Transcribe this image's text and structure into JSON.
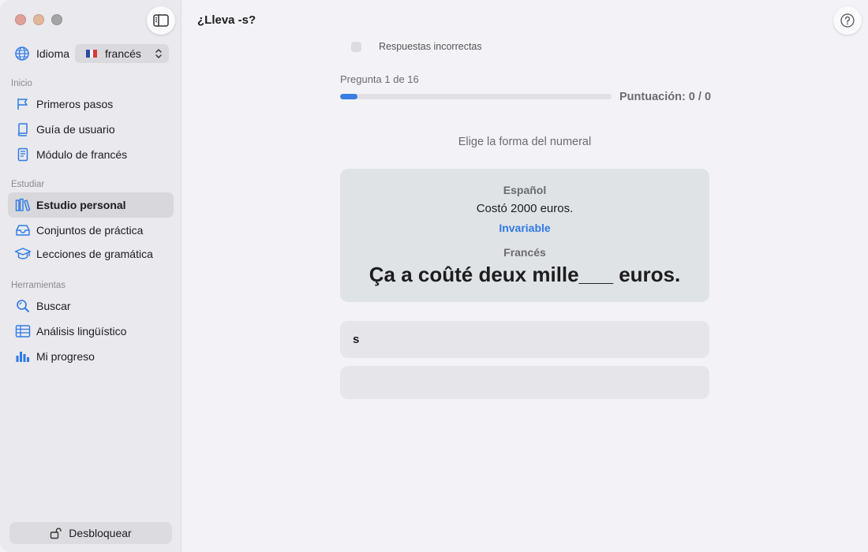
{
  "sidebar": {
    "language_label": "Idioma",
    "language_value": "francés",
    "sections": {
      "inicio": "Inicio",
      "estudiar": "Estudiar",
      "herramientas": "Herramientas"
    },
    "items": {
      "primeros_pasos": "Primeros pasos",
      "guia_usuario": "Guía de usuario",
      "modulo_frances": "Módulo de francés",
      "estudio_personal": "Estudio personal",
      "conjuntos_practica": "Conjuntos de práctica",
      "lecciones_gramatica": "Lecciones de gramática",
      "buscar": "Buscar",
      "analisis_linguistico": "Análisis lingüístico",
      "mi_progreso": "Mi progreso"
    },
    "active_item": "estudio_personal",
    "unlock_label": "Desbloquear"
  },
  "main": {
    "title": "¿Lleva -s?",
    "wrong_answers_label": "Respuestas incorrectas",
    "question_counter": "Pregunta 1 de 16",
    "progress_fraction": 0.0625,
    "score": "Puntuación: 0 / 0",
    "instruction": "Elige la forma del numeral",
    "card": {
      "source_language": "Español",
      "source_sentence": "Costó 2000 euros.",
      "hint": "Invariable",
      "target_language": "Francés",
      "target_sentence": "Ça a coûté deux mille___ euros."
    },
    "answers": [
      "s",
      ""
    ]
  },
  "colors": {
    "accent": "#2f7ae5",
    "progress": "#3a7de0",
    "sidebar_bg": "#e9e9ee",
    "card_bg": "#dfe3e6"
  },
  "icons": {
    "language": "globe-icon",
    "primeros_pasos": "flag-icon",
    "guia_usuario": "book-icon",
    "modulo_frances": "document-icon",
    "estudio_personal": "books-icon",
    "conjuntos_practica": "tray-icon",
    "lecciones_gramatica": "graduation-cap-icon",
    "buscar": "magnifier-icon",
    "analisis_linguistico": "table-icon",
    "mi_progreso": "bar-chart-icon",
    "unlock": "unlock-icon",
    "help": "question-icon",
    "sidebar_toggle": "sidebar-toggle-icon"
  }
}
